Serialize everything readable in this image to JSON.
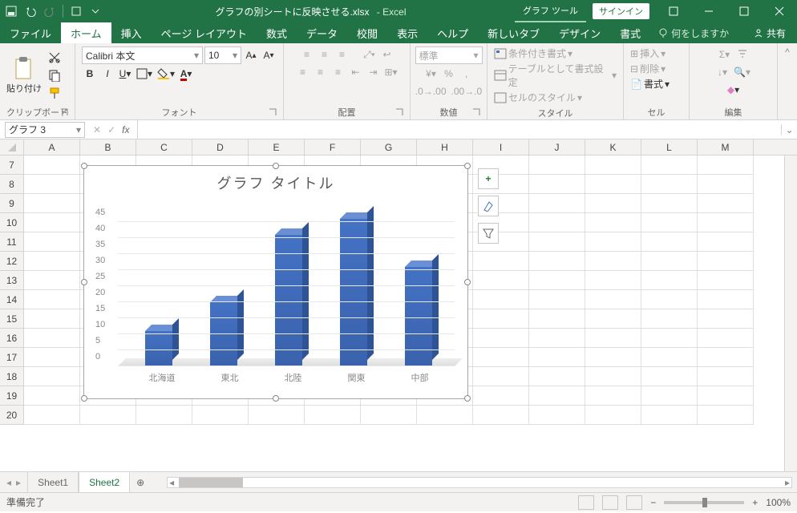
{
  "titlebar": {
    "filename": "グラフの別シートに反映させる.xlsx",
    "app": "Excel",
    "tool_tab": "グラフ ツール",
    "signin": "サインイン"
  },
  "ribbon_tabs": {
    "file": "ファイル",
    "home": "ホーム",
    "insert": "挿入",
    "page_layout": "ページ レイアウト",
    "formulas": "数式",
    "data": "データ",
    "review": "校閲",
    "view": "表示",
    "help": "ヘルプ",
    "new_tab": "新しいタブ",
    "design": "デザイン",
    "format": "書式",
    "tellme": "何をしますか",
    "share": "共有"
  },
  "ribbon": {
    "paste": "貼り付け",
    "clipboard": "クリップボード",
    "font_name": "Calibri 本文",
    "font_size": "10",
    "font_group": "フォント",
    "align_group": "配置",
    "number_fmt": "標準",
    "number_group": "数値",
    "cond_fmt": "条件付き書式",
    "table_fmt": "テーブルとして書式設定",
    "cell_style": "セルのスタイル",
    "style_group": "スタイル",
    "insert_btn": "挿入",
    "delete_btn": "削除",
    "format_btn": "書式",
    "cells_group": "セル",
    "edit_group": "編集"
  },
  "namebox": {
    "name": "グラフ 3"
  },
  "columns": [
    "A",
    "B",
    "C",
    "D",
    "E",
    "F",
    "G",
    "H",
    "I",
    "J",
    "K",
    "L",
    "M"
  ],
  "rows": [
    "7",
    "8",
    "9",
    "10",
    "11",
    "12",
    "13",
    "14",
    "15",
    "16",
    "17",
    "18",
    "19",
    "20"
  ],
  "chart_data": {
    "type": "bar",
    "title": "グラフ タイトル",
    "categories": [
      "北海道",
      "東北",
      "北陸",
      "関東",
      "中部"
    ],
    "values": [
      11,
      20,
      41,
      46,
      31
    ],
    "ylim": [
      0,
      45
    ],
    "yticks": [
      0,
      5,
      10,
      15,
      20,
      25,
      30,
      35,
      40,
      45
    ]
  },
  "sheets": {
    "sheet1": "Sheet1",
    "sheet2": "Sheet2"
  },
  "status": {
    "ready": "準備完了",
    "zoom": "100%"
  }
}
